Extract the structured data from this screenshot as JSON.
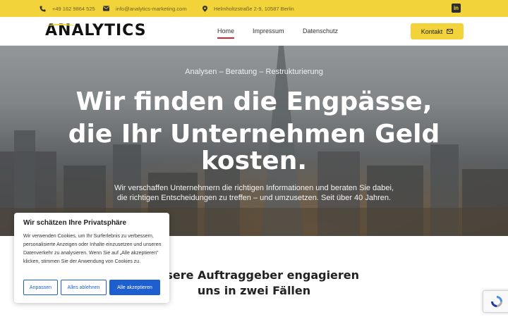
{
  "topbar": {
    "phone": "+49 162 9864 525",
    "email": "info@analytics-marketing.com",
    "address": "Helmholtzstraße 2-9, 10587 Berlin",
    "social_icon": "linkedin-icon",
    "linkedin_label": "in"
  },
  "header": {
    "logo": "ANALYTICS",
    "nav": [
      {
        "label": "Home",
        "active": true
      },
      {
        "label": "Impressum",
        "active": false
      },
      {
        "label": "Datenschutz",
        "active": false
      }
    ],
    "cta_label": "Kontakt",
    "cta_icon": "envelope-icon"
  },
  "hero": {
    "eyebrow": "Analysen – Beratung – Restrukturierung",
    "headline_lines": [
      "Wir finden die Engpässe,",
      "die Ihr Unternehmen Geld",
      "kosten."
    ],
    "sub_lines": [
      "Wir verschaffen Unternehmern die richtigen Informationen und beraten Sie dabei,",
      "die richtigen Entscheidungen zu treffen – und umzusetzen. Seit über 40 Jahren."
    ]
  },
  "section": {
    "title_lines": [
      "Unsere Auftraggeber engagieren",
      "uns in zwei Fällen"
    ]
  },
  "cookie": {
    "title": "Wir schätzen Ihre Privatsphäre",
    "text": "Wir verwenden Cookies, um Ihr Surferlebnis zu verbessern, personalisierte Anzeigen oder Inhalte einzusetzen und unseren Datenverkehr zu analysieren. Wenn Sie auf „Alle akzeptieren\" klicken, stimmen Sie der Anwendung von Cookies zu.",
    "buttons": {
      "customize": "Anpassen",
      "reject": "Alles ablehnen",
      "accept": "Alle akzeptieren"
    }
  },
  "colors": {
    "accent": "#f2d43a",
    "nav_active": "#d9262c",
    "cookie_button": "#1e5fd0"
  }
}
